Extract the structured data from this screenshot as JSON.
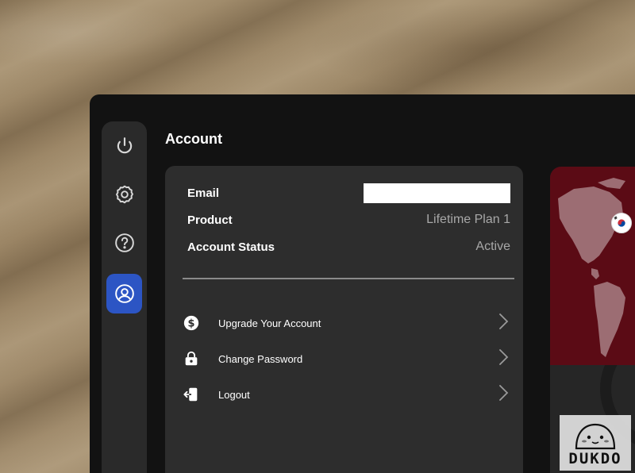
{
  "header": {
    "title": "Account"
  },
  "sidebar": {
    "items": [
      {
        "icon": "power-icon",
        "active": false
      },
      {
        "icon": "gear-icon",
        "active": false
      },
      {
        "icon": "help-icon",
        "active": false
      },
      {
        "icon": "user-circle-icon",
        "active": true
      }
    ]
  },
  "account": {
    "email_label": "Email",
    "email_value": "",
    "product_label": "Product",
    "product_value": "Lifetime Plan 1",
    "status_label": "Account Status",
    "status_value": "Active"
  },
  "menu": {
    "items": [
      {
        "label": "Upgrade Your Account",
        "icon": "dollar-icon"
      },
      {
        "label": "Change Password",
        "icon": "lock-icon"
      },
      {
        "label": "Logout",
        "icon": "logout-icon"
      }
    ]
  },
  "watermark": {
    "text": "DUKDO"
  },
  "colors": {
    "accent": "#2c55c4",
    "window_bg": "#121212",
    "card_bg": "#2d2d2d",
    "map_bg": "#5b0b15",
    "map_land": "#9c6d73"
  }
}
